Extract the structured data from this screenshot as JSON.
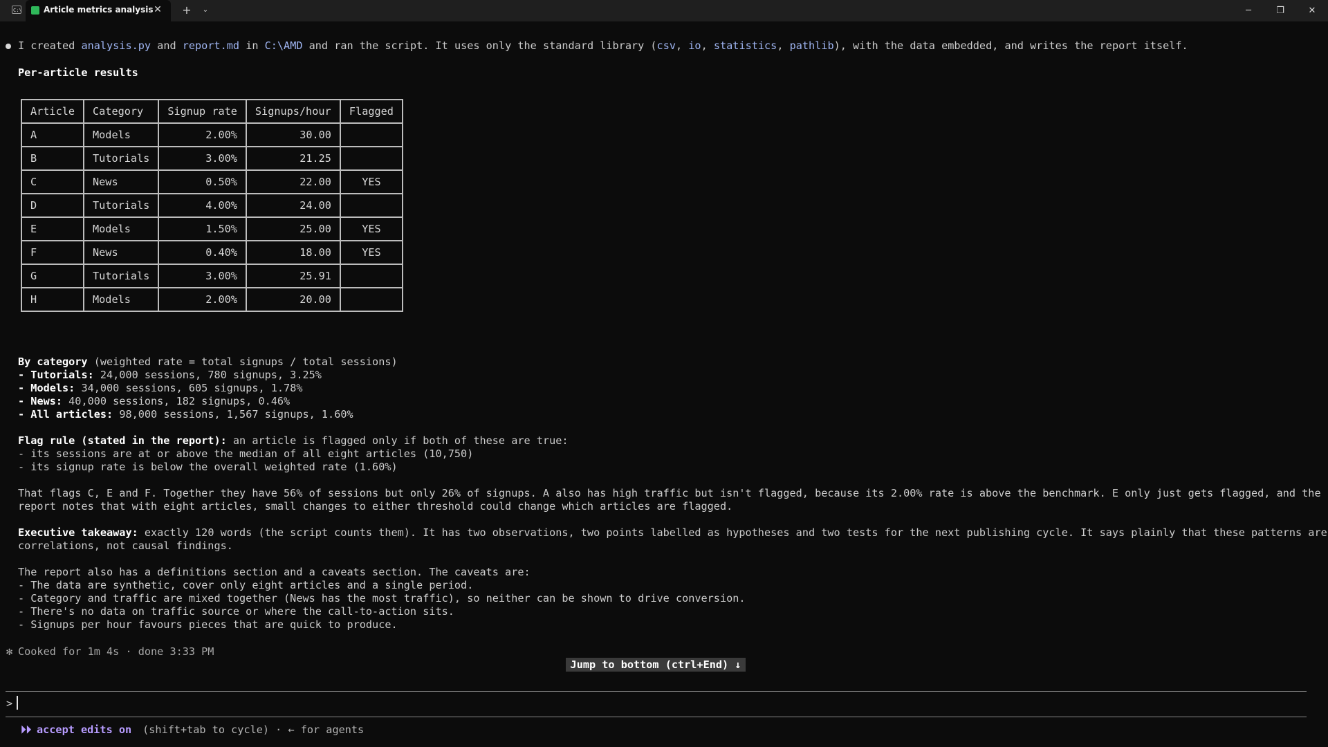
{
  "window": {
    "tab_title": "Article metrics analysis an",
    "tab_close": "✕",
    "new_tab": "+",
    "tab_dropdown": "⌄",
    "app_icon": "C:\\",
    "minimize": "─",
    "maximize": "❐",
    "close": "✕"
  },
  "message": {
    "intro": {
      "t1": "I created ",
      "file1": "analysis.py",
      "t2": " and ",
      "file2": "report.md",
      "t3": " in ",
      "path": "C:\\AMD",
      "t4": " and ran the script. It uses only the standard library (",
      "lib1": "csv",
      "sep1": ", ",
      "lib2": "io",
      "sep2": ", ",
      "lib3": "statistics",
      "sep3": ", ",
      "lib4": "pathlib",
      "t5": "), with the data embedded, and writes the report itself."
    },
    "per_article_heading": "Per-article results",
    "table": {
      "headers": [
        "Article",
        "Category",
        "Signup rate",
        "Signups/hour",
        "Flagged"
      ],
      "rows": [
        [
          "A",
          "Models",
          "2.00%",
          "30.00",
          ""
        ],
        [
          "B",
          "Tutorials",
          "3.00%",
          "21.25",
          ""
        ],
        [
          "C",
          "News",
          "0.50%",
          "22.00",
          "YES"
        ],
        [
          "D",
          "Tutorials",
          "4.00%",
          "24.00",
          ""
        ],
        [
          "E",
          "Models",
          "1.50%",
          "25.00",
          "YES"
        ],
        [
          "F",
          "News",
          "0.40%",
          "18.00",
          "YES"
        ],
        [
          "G",
          "Tutorials",
          "3.00%",
          "25.91",
          ""
        ],
        [
          "H",
          "Models",
          "2.00%",
          "20.00",
          ""
        ]
      ]
    },
    "by_category": {
      "heading": "By category",
      "note": " (weighted rate = total signups / total sessions)",
      "items": [
        {
          "label": "Tutorials:",
          "text": " 24,000 sessions, 780 signups, 3.25%"
        },
        {
          "label": "Models:",
          "text": " 34,000 sessions, 605 signups, 1.78%"
        },
        {
          "label": "News:",
          "text": " 40,000 sessions, 182 signups, 0.46%"
        },
        {
          "label": "All articles:",
          "text": " 98,000 sessions, 1,567 signups, 1.60%"
        }
      ]
    },
    "flag_rule": {
      "heading": "Flag rule (stated in the report):",
      "text": " an article is flagged only if both of these are true:",
      "items": [
        "- its sessions are at or above the median of all eight articles (10,750)",
        "- its signup rate is below the overall weighted rate (1.60%)"
      ]
    },
    "flags_para": [
      "That flags C, E and F. Together they have 56% of sessions but only 26% of signups. A also has high traffic but isn't flagged, because its 2.00% rate is above the benchmark. E only just gets flagged, and the",
      "report notes that with eight articles, small changes to either threshold could change which articles are flagged."
    ],
    "takeaway": {
      "heading": "Executive takeaway:",
      "line1": " exactly 120 words (the script counts them). It has two observations, two points labelled as hypotheses and two tests for the next publishing cycle. It says plainly that these patterns are",
      "line2": "correlations, not causal findings."
    },
    "caveats": {
      "intro": "The report also has a definitions section and a caveats section. The caveats are:",
      "items": [
        "- The data are synthetic, cover only eight articles and a single period.",
        "- Category and traffic are mixed together (News has the most traffic), so neither can be shown to drive conversion.",
        "- There's no data on traffic source or where the call-to-action sits.",
        "- Signups per hour favours pieces that are quick to produce."
      ]
    }
  },
  "status": {
    "spinner": "✻",
    "cooked": "Cooked for 1m 4s · done 3:33 PM"
  },
  "jump_button": "Jump to bottom (ctrl+End) ↓",
  "prompt": {
    "symbol": ">"
  },
  "mode": {
    "icon": "⏵⏵",
    "label": "accept edits on",
    "hint": " (shift+tab to cycle) · ← for agents"
  }
}
